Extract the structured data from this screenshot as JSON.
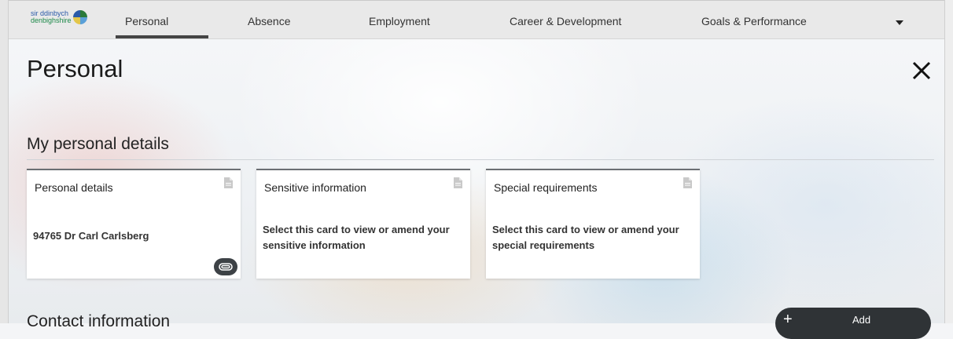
{
  "nav": {
    "logo_line1": "sir ddinbych",
    "logo_line2": "denbighshire",
    "items": [
      {
        "label": "Personal"
      },
      {
        "label": "Absence"
      },
      {
        "label": "Employment"
      },
      {
        "label": "Career & Development"
      },
      {
        "label": "Goals & Performance"
      }
    ],
    "more_icon": "chevron-down-icon"
  },
  "page": {
    "title": "Personal",
    "close_icon": "close-icon"
  },
  "section": {
    "title": "My personal details"
  },
  "cards": [
    {
      "title": "Personal details",
      "body": "94765 Dr Carl Carlsberg",
      "icon": "document-icon",
      "badge_icon": "attachment-icon"
    },
    {
      "title": "Sensitive information",
      "body": "Select this card to view or amend your sensitive information",
      "icon": "document-icon"
    },
    {
      "title": "Special requirements",
      "body": "Select this card to view or amend your special requirements",
      "icon": "document-icon"
    }
  ],
  "contact": {
    "title": "Contact information",
    "add_label": "Add",
    "add_icon": "plus-icon"
  },
  "colors": {
    "card_border": "#6b6f73",
    "button_dark": "#2f3336",
    "nav_background": "#e9e9e9"
  }
}
